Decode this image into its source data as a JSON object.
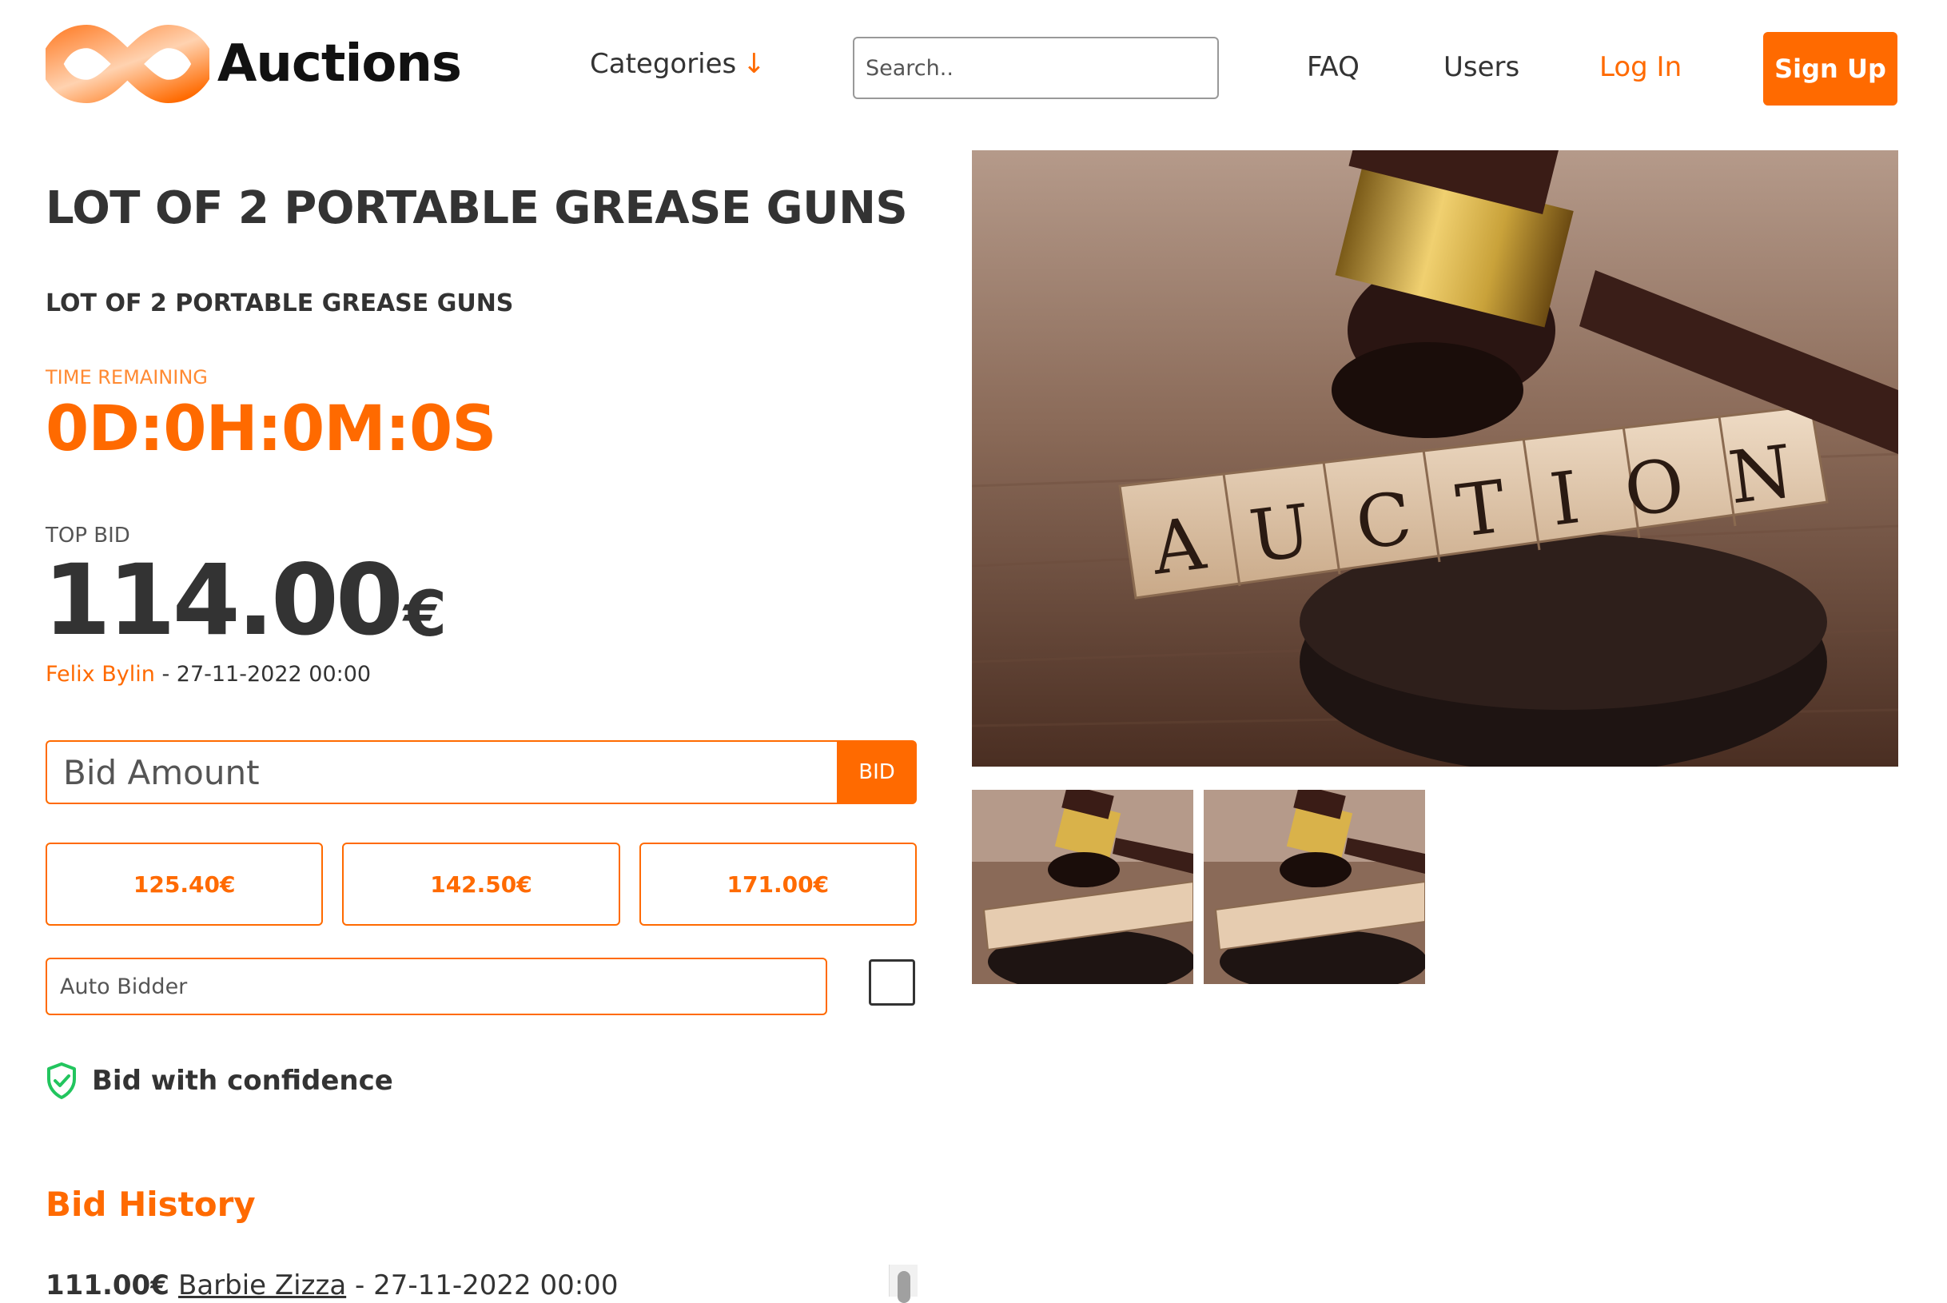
{
  "header": {
    "logo_text": "Auctions",
    "categories_label": "Categories",
    "categories_arrow": "↓",
    "search_placeholder": "Search..",
    "nav": {
      "faq": "FAQ",
      "users": "Users",
      "login": "Log In",
      "signup": "Sign Up"
    },
    "colors": {
      "accent": "#ff6a00"
    }
  },
  "item": {
    "title": "LOT OF 2 PORTABLE GREASE GUNS",
    "description": "LOT OF 2 PORTABLE GREASE GUNS",
    "time_remaining_label": "TIME REMAINING",
    "time_remaining": "0D:0H:0M:0S",
    "top_bid_label": "TOP BID",
    "top_bid_amount": "114.00",
    "currency": "€",
    "top_bidder": "Felix Bylin",
    "top_bid_separator": " - ",
    "top_bid_time": "27-11-2022 00:00",
    "image_word": "AUCTION"
  },
  "bid_form": {
    "amount_placeholder": "Bid Amount",
    "bid_button": "BID",
    "quick_bids": [
      "125.40€",
      "142.50€",
      "171.00€"
    ],
    "auto_bidder_placeholder": "Auto Bidder",
    "auto_bidder_checked": false
  },
  "confidence": {
    "label": "Bid with confidence",
    "icon": "shield-check-icon",
    "icon_color": "#22c55e"
  },
  "history": {
    "title": "Bid History",
    "rows": [
      {
        "amount": "111.00€",
        "user": "Barbie Zizza",
        "separator": " - ",
        "time": "27-11-2022 00:00"
      }
    ]
  }
}
